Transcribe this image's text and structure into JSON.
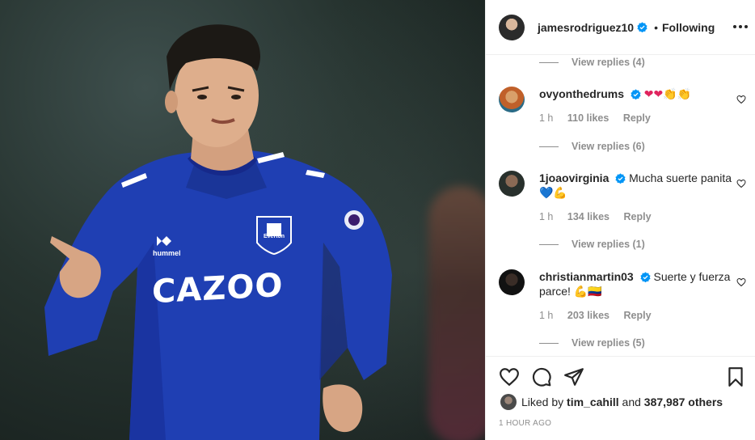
{
  "colors": {
    "shirt_blue": "#1f3fb3",
    "verified_blue": "#0095f6",
    "text_primary": "#262626",
    "text_secondary": "#8e8e8e"
  },
  "media": {
    "shirt_sponsor": "CAZOO",
    "shirt_brand": "hummel",
    "crest_text": "Everton"
  },
  "header": {
    "username": "jamesrodriguez10",
    "separator": "•",
    "follow_state": "Following",
    "icons": {
      "verified": "verified-badge-icon",
      "more": "more-options-icon"
    }
  },
  "comments": {
    "top_view_replies": "View replies (4)",
    "items": [
      {
        "username": "ovyonthedrums",
        "text": "",
        "emojis": "❤❤👏👏",
        "time": "1 h",
        "likes": "110 likes",
        "reply": "Reply",
        "view_replies": "View replies (6)"
      },
      {
        "username": "1joaovirginia",
        "text": "Mucha suerte panita",
        "emojis": "💙💪",
        "time": "1 h",
        "likes": "134 likes",
        "reply": "Reply",
        "view_replies": "View replies (1)"
      },
      {
        "username": "christianmartin03",
        "text": "Suerte y fuerza parce!",
        "emojis": "💪🇨🇴",
        "time": "1 h",
        "likes": "203 likes",
        "reply": "Reply",
        "view_replies": "View replies (5)"
      }
    ]
  },
  "actions": {
    "icons": [
      "heart-icon",
      "comment-icon",
      "share-icon",
      "bookmark-icon"
    ],
    "liked_prefix": "Liked by",
    "liked_user": "tim_cahill",
    "liked_and": "and",
    "liked_others": "387,987 others",
    "timestamp": "1 HOUR AGO"
  }
}
